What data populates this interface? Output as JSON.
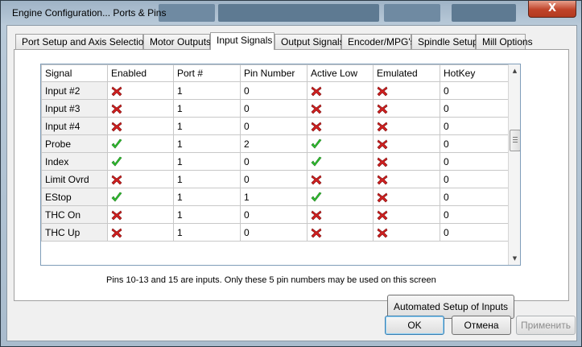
{
  "window": {
    "title": "Engine Configuration... Ports & Pins",
    "close_label": "X"
  },
  "tabs": [
    {
      "label": "Port Setup and Axis Selection"
    },
    {
      "label": "Motor Outputs"
    },
    {
      "label": "Input Signals"
    },
    {
      "label": "Output Signals"
    },
    {
      "label": "Encoder/MPG's"
    },
    {
      "label": "Spindle Setup"
    },
    {
      "label": "Mill Options"
    }
  ],
  "table": {
    "headers": [
      "Signal",
      "Enabled",
      "Port #",
      "Pin Number",
      "Active Low",
      "Emulated",
      "HotKey"
    ],
    "rows": [
      {
        "signal": "Input #2",
        "enabled": false,
        "port": "1",
        "pin": "0",
        "active_low": false,
        "emulated": false,
        "hotkey": "0"
      },
      {
        "signal": "Input #3",
        "enabled": false,
        "port": "1",
        "pin": "0",
        "active_low": false,
        "emulated": false,
        "hotkey": "0"
      },
      {
        "signal": "Input #4",
        "enabled": false,
        "port": "1",
        "pin": "0",
        "active_low": false,
        "emulated": false,
        "hotkey": "0"
      },
      {
        "signal": "Probe",
        "enabled": true,
        "port": "1",
        "pin": "2",
        "active_low": true,
        "emulated": false,
        "hotkey": "0"
      },
      {
        "signal": "Index",
        "enabled": true,
        "port": "1",
        "pin": "0",
        "active_low": true,
        "emulated": false,
        "hotkey": "0"
      },
      {
        "signal": "Limit Ovrd",
        "enabled": false,
        "port": "1",
        "pin": "0",
        "active_low": false,
        "emulated": false,
        "hotkey": "0"
      },
      {
        "signal": "EStop",
        "enabled": true,
        "port": "1",
        "pin": "1",
        "active_low": true,
        "emulated": false,
        "hotkey": "0"
      },
      {
        "signal": "THC On",
        "enabled": false,
        "port": "1",
        "pin": "0",
        "active_low": false,
        "emulated": false,
        "hotkey": "0"
      },
      {
        "signal": "THC Up",
        "enabled": false,
        "port": "1",
        "pin": "0",
        "active_low": false,
        "emulated": false,
        "hotkey": "0"
      }
    ],
    "check_icons": {
      "true": "green-check-icon",
      "false": "red-x-icon"
    }
  },
  "note": "Pins 10-13 and 15 are inputs. Only these 5 pin numbers may be used on this screen",
  "buttons": {
    "automated": "Automated Setup of Inputs",
    "ok": "OK",
    "cancel": "Отмена",
    "apply": "Применить"
  },
  "colors": {
    "check": "#2fbf2f",
    "cross": "#d21f1f"
  }
}
